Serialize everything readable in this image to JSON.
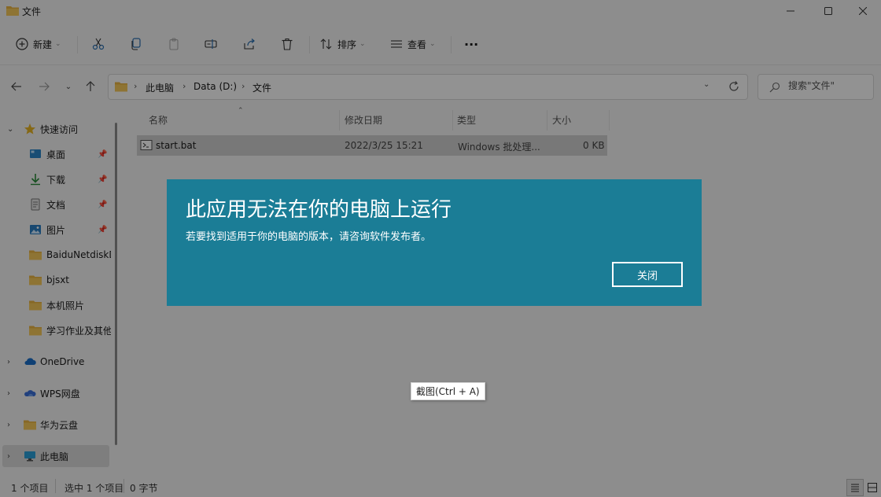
{
  "window": {
    "title": "文件"
  },
  "toolbar": {
    "new_label": "新建",
    "sort_label": "排序",
    "view_label": "查看",
    "more_label": "···"
  },
  "address": {
    "crumbs": [
      "此电脑",
      "Data (D:)",
      "文件"
    ],
    "search_placeholder": "搜索\"文件\""
  },
  "sidebar": {
    "quick_access": "快速访问",
    "items": [
      {
        "label": "桌面"
      },
      {
        "label": "下载"
      },
      {
        "label": "文档"
      },
      {
        "label": "图片"
      },
      {
        "label": "BaiduNetdiskDownload"
      },
      {
        "label": "bjsxt"
      },
      {
        "label": "本机照片"
      },
      {
        "label": "学习作业及其他"
      }
    ],
    "onedrive": "OneDrive",
    "wps": "WPS网盘",
    "huawei": "华为云盘",
    "thispc": "此电脑"
  },
  "columns": {
    "name": "名称",
    "modified": "修改日期",
    "type": "类型",
    "size": "大小"
  },
  "files": [
    {
      "name": "start.bat",
      "modified": "2022/3/25 15:21",
      "type": "Windows 批处理...",
      "size": "0 KB"
    }
  ],
  "status": {
    "count": "1 个项目",
    "selected": "选中 1 个项目",
    "bytes": "0 字节"
  },
  "dialog": {
    "title": "此应用无法在你的电脑上运行",
    "message": "若要找到适用于你的电脑的版本，请咨询软件发布者。",
    "close_label": "关闭",
    "color": "#1b7d96"
  },
  "tooltip": {
    "text": "截图(Ctrl + A)"
  }
}
